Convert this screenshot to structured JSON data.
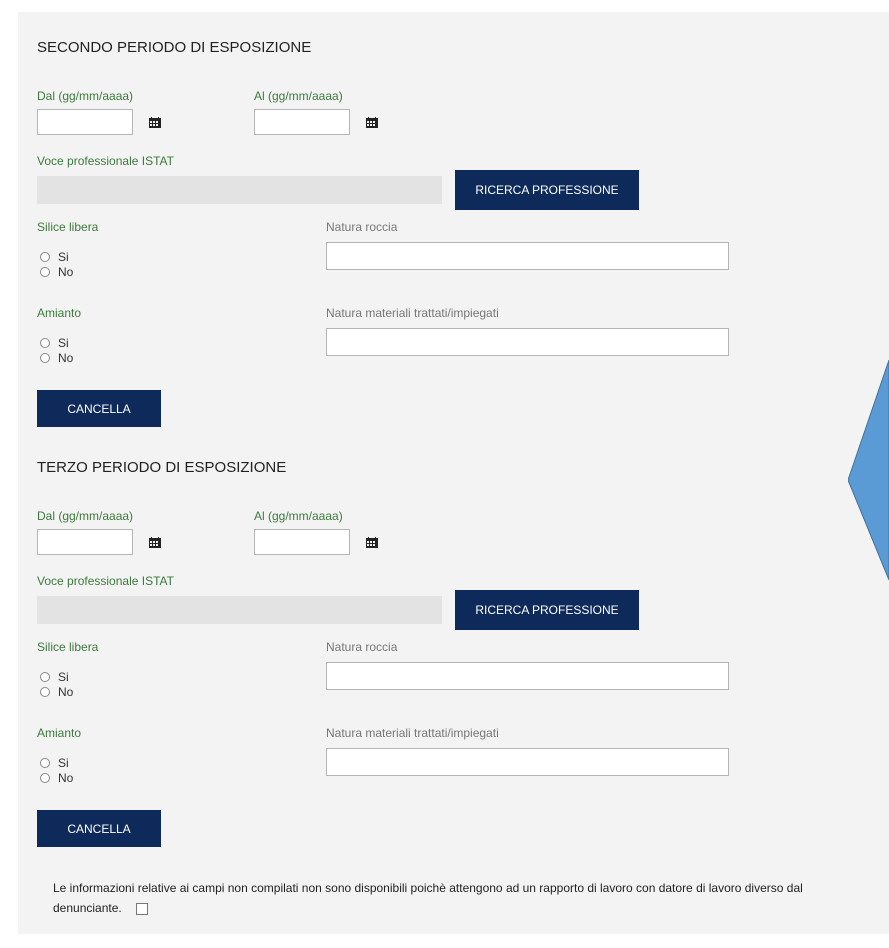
{
  "sections": [
    {
      "title": "SECONDO PERIODO DI ESPOSIZIONE",
      "dal_label": "Dal (gg/mm/aaaa)",
      "al_label": "Al (gg/mm/aaaa)",
      "istat_label": "Voce professionale ISTAT",
      "ricerca_label": "RICERCA PROFESSIONE",
      "silice_label": "Silice libera",
      "natura_roccia_label": "Natura roccia",
      "amianto_label": "Amianto",
      "natura_materiali_label": "Natura materiali trattati/impiegati",
      "option_si": "Si",
      "option_no": "No",
      "cancella_label": "CANCELLA"
    },
    {
      "title": "TERZO PERIODO DI ESPOSIZIONE",
      "dal_label": "Dal (gg/mm/aaaa)",
      "al_label": "Al (gg/mm/aaaa)",
      "istat_label": "Voce professionale ISTAT",
      "ricerca_label": "RICERCA PROFESSIONE",
      "silice_label": "Silice libera",
      "natura_roccia_label": "Natura roccia",
      "amianto_label": "Amianto",
      "natura_materiali_label": "Natura materiali trattati/impiegati",
      "option_si": "Si",
      "option_no": "No",
      "cancella_label": "CANCELLA"
    }
  ],
  "note": {
    "text": "Le informazioni relative ai campi non compilati non sono disponibili poichè attengono ad un rapporto di lavoro con datore di lavoro diverso dal denunciante."
  },
  "colors": {
    "button_bg": "#0e2a5a",
    "green_label": "#3c7a3c",
    "panel_bg": "#f3f3f3",
    "arrow_fill": "#5b9bd5"
  },
  "icons": [
    "calendar-icon"
  ]
}
